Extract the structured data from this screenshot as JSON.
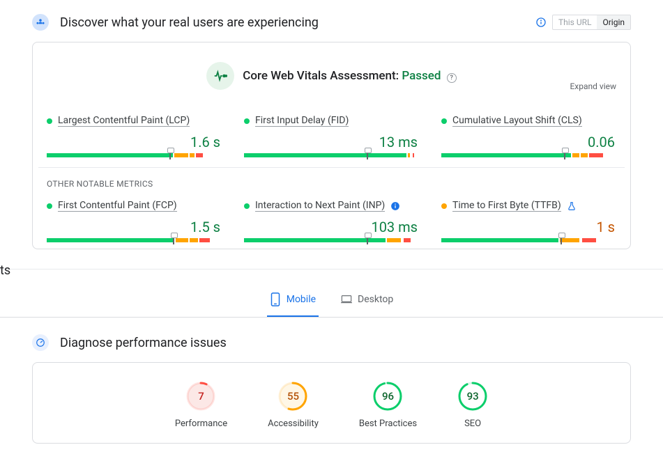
{
  "header": {
    "title": "Discover what your real users are experiencing",
    "toggle": {
      "url": "This URL",
      "origin": "Origin"
    }
  },
  "cwv": {
    "title_prefix": "Core Web Vitals Assessment: ",
    "status": "Passed",
    "expand": "Expand view"
  },
  "metrics": [
    {
      "label": "Largest Contentful Paint (LCP)",
      "value": "1.6 s",
      "dot": "green",
      "valClass": "green",
      "segs": [
        72,
        0,
        8,
        0,
        3,
        0,
        4
      ],
      "marker": 70
    },
    {
      "label": "First Input Delay (FID)",
      "value": "13 ms",
      "dot": "green",
      "valClass": "green",
      "segs": [
        93,
        0,
        1,
        0,
        0,
        0,
        1
      ],
      "marker": 70
    },
    {
      "label": "Cumulative Layout Shift (CLS)",
      "value": "0.06",
      "dot": "green",
      "valClass": "green",
      "segs": [
        74,
        0,
        4,
        0,
        4,
        0,
        8
      ],
      "marker": 70
    },
    {
      "label": "First Contentful Paint (FCP)",
      "value": "1.5 s",
      "dot": "green",
      "valClass": "green",
      "segs": [
        73,
        0,
        7,
        0,
        5,
        0,
        6
      ],
      "marker": 72
    },
    {
      "label": "Interaction to Next Paint (INP)",
      "value": "103 ms",
      "dot": "green",
      "valClass": "green",
      "segs": [
        81,
        0,
        8,
        0,
        0,
        0,
        4
      ],
      "marker": 70,
      "info": true
    },
    {
      "label": "Time to First Byte (TTFB)",
      "value": "1 s",
      "dot": "orange",
      "valClass": "orange",
      "segs": [
        67,
        0,
        11,
        0,
        0,
        0,
        8
      ],
      "marker": 68,
      "beta": true
    }
  ],
  "subheader": "OTHER NOTABLE METRICS",
  "truncated": "ts",
  "tabs": {
    "mobile": "Mobile",
    "desktop": "Desktop"
  },
  "diagnose": {
    "title": "Diagnose performance issues"
  },
  "scores": [
    {
      "label": "Performance",
      "value": "7",
      "color": "red",
      "pct": 7
    },
    {
      "label": "Accessibility",
      "value": "55",
      "color": "orange",
      "pct": 55
    },
    {
      "label": "Best Practices",
      "value": "96",
      "color": "green",
      "pct": 96
    },
    {
      "label": "SEO",
      "value": "93",
      "color": "green",
      "pct": 93
    }
  ]
}
